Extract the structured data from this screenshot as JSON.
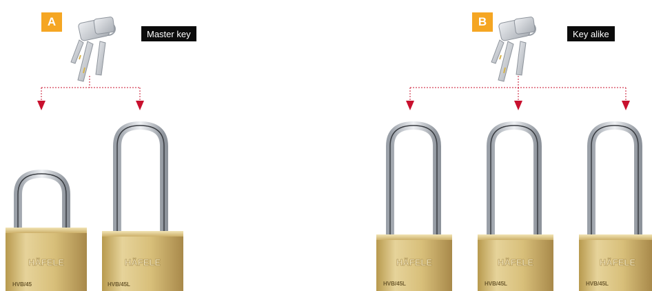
{
  "sections": [
    {
      "badge": "A",
      "label": "Master key",
      "padlocks": [
        {
          "brand": "HÄFELE",
          "model": "HVB/45"
        },
        {
          "brand": "HÄFELE",
          "model": "HVB/45L"
        }
      ]
    },
    {
      "badge": "B",
      "label": "Key alike",
      "padlocks": [
        {
          "brand": "HÄFELE",
          "model": "HVB/45L"
        },
        {
          "brand": "HÄFELE",
          "model": "HVB/45L"
        },
        {
          "brand": "HÄFELE",
          "model": "HVB/45L"
        }
      ]
    }
  ],
  "colors": {
    "badge": "#f5a623",
    "label_bg": "#0b0b0b",
    "connector": "#c8102e",
    "brass": "#d9c27a",
    "steel": "#c9ccd1"
  },
  "icons": [
    "key-bunch-icon",
    "padlock-icon",
    "arrow-down-icon"
  ]
}
